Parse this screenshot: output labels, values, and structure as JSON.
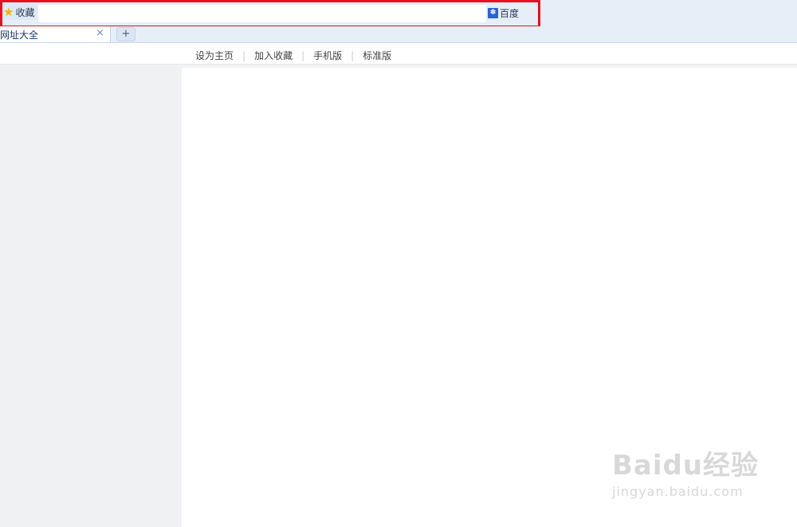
{
  "favorites": {
    "label": "收藏",
    "icon": "star-icon"
  },
  "address": {
    "value": ""
  },
  "search_engine": {
    "label": "百度",
    "icon": "baidu-paw-icon"
  },
  "tabs": [
    {
      "title": "网址大全",
      "close": "×"
    }
  ],
  "new_tab": "+",
  "page_nav": [
    "设为主页",
    "加入收藏",
    "手机版",
    "标准版"
  ],
  "watermark": {
    "logo": "Baidu经验",
    "url": "jingyan.baidu.com"
  },
  "colors": {
    "highlight": "#e8121e",
    "toolbar_bg": "#e6eef8",
    "sidebar_bg": "#f0f1f3"
  }
}
